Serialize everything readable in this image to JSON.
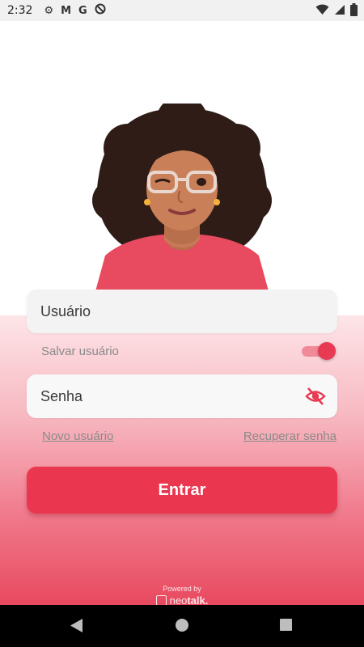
{
  "status_bar": {
    "time": "2:32",
    "icons_left": [
      "gear-icon",
      "gmail-icon",
      "google-icon",
      "vpn-icon"
    ],
    "icons_right": [
      "wifi-icon",
      "signal-icon",
      "battery-icon"
    ]
  },
  "form": {
    "username_placeholder": "Usuário",
    "save_user_label": "Salvar usuário",
    "save_user_toggle": true,
    "password_placeholder": "Senha",
    "new_user_link": "Novo usuário",
    "recover_password_link": "Recuperar senha",
    "enter_button": "Entrar"
  },
  "footer": {
    "powered_by": "Powered by",
    "brand_regular": "neo",
    "brand_bold": "talk."
  },
  "colors": {
    "accent": "#ea364f",
    "toggle_track": "#f08a99",
    "field_bg": "#f3f3f4"
  }
}
